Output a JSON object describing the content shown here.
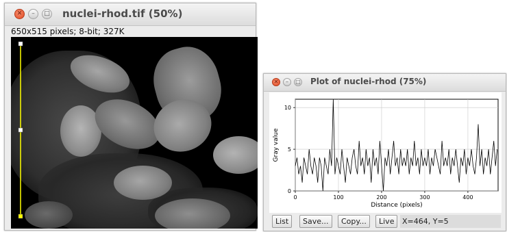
{
  "image_window": {
    "title": "nuclei-rhod.tif (50%)",
    "info": "650x515 pixels; 8-bit; 327K",
    "selection_color": "#ffff00"
  },
  "plot_window": {
    "title": "Plot of nuclei-rhod (75%)",
    "buttons": {
      "list": "List",
      "save": "Save...",
      "copy": "Copy...",
      "live": "Live"
    },
    "coordinates": "X=464,  Y=5"
  },
  "chart_data": {
    "type": "line",
    "xlabel": "Distance (pixels)",
    "ylabel": "Gray value",
    "xlim": [
      0,
      470
    ],
    "ylim": [
      0,
      11
    ],
    "x_ticks": [
      "0",
      "100",
      "200",
      "300",
      "400"
    ],
    "y_ticks": [
      "0",
      "5",
      "10"
    ],
    "grid": true,
    "x": [
      0,
      4,
      8,
      12,
      16,
      20,
      24,
      28,
      32,
      36,
      40,
      44,
      48,
      52,
      56,
      60,
      64,
      68,
      72,
      76,
      80,
      84,
      88,
      92,
      96,
      100,
      104,
      108,
      112,
      116,
      120,
      124,
      128,
      132,
      136,
      140,
      144,
      148,
      152,
      156,
      160,
      164,
      168,
      172,
      176,
      180,
      184,
      188,
      192,
      196,
      200,
      204,
      208,
      212,
      216,
      220,
      224,
      228,
      232,
      236,
      240,
      244,
      248,
      252,
      256,
      260,
      264,
      268,
      272,
      276,
      280,
      284,
      288,
      292,
      296,
      300,
      304,
      308,
      312,
      316,
      320,
      324,
      328,
      332,
      336,
      340,
      344,
      348,
      352,
      356,
      360,
      364,
      368,
      372,
      376,
      380,
      384,
      388,
      392,
      396,
      400,
      404,
      408,
      412,
      416,
      420,
      424,
      428,
      432,
      436,
      440,
      444,
      448,
      452,
      456,
      460,
      464,
      468
    ],
    "values": [
      3,
      4,
      2,
      3,
      1,
      4,
      3,
      2,
      5,
      3,
      2,
      4,
      3,
      1,
      4,
      3,
      0,
      4,
      3,
      2,
      5,
      3,
      11,
      2,
      4,
      3,
      2,
      5,
      3,
      1,
      4,
      3,
      2,
      4,
      5,
      3,
      2,
      6,
      3,
      4,
      2,
      5,
      3,
      4,
      1,
      5,
      3,
      4,
      2,
      6,
      3,
      0,
      4,
      3,
      5,
      2,
      4,
      6,
      3,
      4,
      2,
      5,
      3,
      4,
      3,
      5,
      2,
      4,
      3,
      6,
      3,
      4,
      2,
      5,
      3,
      4,
      3,
      5,
      2,
      4,
      3,
      5,
      4,
      3,
      2,
      6,
      3,
      4,
      3,
      5,
      2,
      4,
      3,
      5,
      3,
      1,
      4,
      3,
      5,
      2,
      4,
      3,
      5,
      3,
      2,
      4,
      8,
      3,
      5,
      2,
      4,
      3,
      5,
      2,
      4,
      6,
      3,
      5
    ]
  }
}
